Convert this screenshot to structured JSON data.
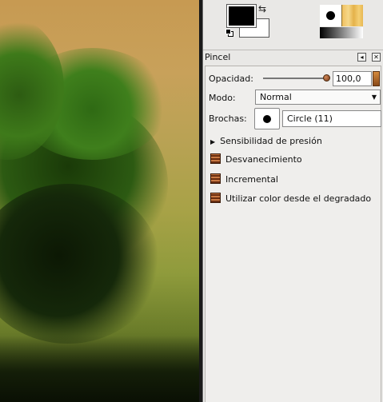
{
  "toolbox": {
    "fg_color": "#000000",
    "bg_color": "#ffffff",
    "swap_icon": "swap-colors-icon",
    "reset_icon": "default-colors-icon"
  },
  "panel": {
    "title": "Pincel",
    "opacity": {
      "label": "Opacidad:",
      "value": "100,0",
      "level": 100
    },
    "mode": {
      "label": "Modo:",
      "value": "Normal"
    },
    "brush": {
      "label": "Brochas:",
      "value": "Circle (11)"
    },
    "expander": {
      "label": "Sensibilidad de presión"
    },
    "options": [
      {
        "label": "Desvanecimiento"
      },
      {
        "label": "Incremental"
      },
      {
        "label": "Utilizar color desde el degradado"
      }
    ]
  },
  "colors": {
    "accent": "#c87842",
    "canvas_bg": "#c79a52"
  }
}
